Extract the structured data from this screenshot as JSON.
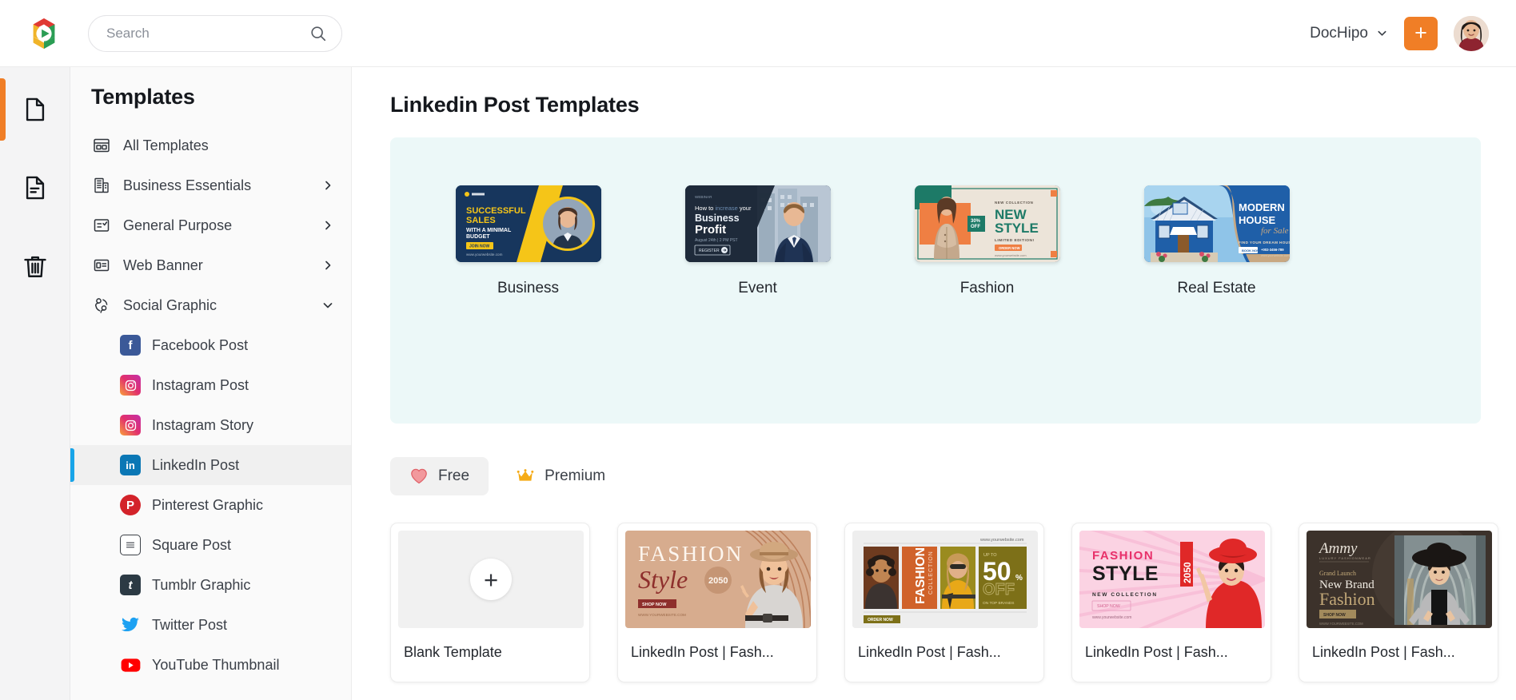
{
  "topbar": {
    "logo_icon": "dochipo-logo-icon",
    "search": {
      "value": "",
      "placeholder": "Search",
      "icon": "search-icon"
    },
    "workspace": {
      "name": "DocHipo",
      "chevron_icon": "chevron-down-icon"
    },
    "add_button": {
      "label": "+",
      "icon": "plus-icon",
      "color": "#f07e26"
    },
    "avatar": {
      "alt": "user-avatar"
    }
  },
  "rail": {
    "items": [
      {
        "icon": "document-blank-icon",
        "active": true
      },
      {
        "icon": "document-lines-icon",
        "active": false
      },
      {
        "icon": "trash-icon",
        "active": false
      }
    ],
    "active_color": "#f07e26"
  },
  "sidebar": {
    "title": "Templates",
    "nav": [
      {
        "label": "All Templates",
        "icon": "grid-layout-icon",
        "arrow": ""
      },
      {
        "label": "Business Essentials",
        "icon": "building-icon",
        "arrow": "chevron-right-icon"
      },
      {
        "label": "General Purpose",
        "icon": "checklist-icon",
        "arrow": "chevron-right-icon"
      },
      {
        "label": "Web Banner",
        "icon": "banner-icon",
        "arrow": "chevron-right-icon"
      },
      {
        "label": "Social Graphic",
        "icon": "people-icon",
        "arrow": "chevron-down-icon",
        "expanded": true
      }
    ],
    "sub_items": [
      {
        "label": "Facebook Post",
        "icon": "facebook-icon",
        "color": "#3b5998",
        "active": false
      },
      {
        "label": "Instagram Post",
        "icon": "instagram-icon",
        "color": "#e1306c",
        "active": false
      },
      {
        "label": "Instagram Story",
        "icon": "instagram-icon",
        "color": "#e1306c",
        "active": false
      },
      {
        "label": "LinkedIn Post",
        "icon": "linkedin-icon",
        "color": "#0a77b5",
        "active": true
      },
      {
        "label": "Pinterest Graphic",
        "icon": "pinterest-icon",
        "color": "#d3232a",
        "active": false
      },
      {
        "label": "Square Post",
        "icon": "square-post-icon",
        "color": "#ffffff",
        "active": false
      },
      {
        "label": "Tumblr Graphic",
        "icon": "tumblr-icon",
        "color": "#2c3a44",
        "active": false
      },
      {
        "label": "Twitter Post",
        "icon": "twitter-icon",
        "color": "#1da1f2",
        "active": false
      },
      {
        "label": "YouTube Thumbnail",
        "icon": "youtube-icon",
        "color": "#ff0000",
        "active": false
      }
    ],
    "active_indicator_color": "#18a4e8"
  },
  "main": {
    "page_title": "Linkedin Post Templates",
    "category_panel_bg": "#ecf8f8",
    "categories": [
      {
        "label": "Business",
        "thumb_headline": "SUCCESSFUL SALES",
        "thumb_sub": "WITH A MINIMAL BUDGET",
        "thumb_cta": "JOIN NOW",
        "thumb_url": "www.yourwebsite.com",
        "bg": "#17365d",
        "accent": "#f5c518"
      },
      {
        "label": "Event",
        "thumb_headline": "Business Profit",
        "thumb_sub": "How to increase your",
        "thumb_cta": "REGISTER",
        "thumb_url": "August 24th | 2 PM PST",
        "bg": "#1e2a3a",
        "accent": "#ffffff"
      },
      {
        "label": "Fashion",
        "thumb_headline": "NEW STYLE",
        "thumb_sub": "LIMITED EDITION!",
        "thumb_cta": "ORDER NOW",
        "thumb_url": "30% OFF",
        "bg": "#ece4d9",
        "accent": "#1d7a67"
      },
      {
        "label": "Real Estate",
        "thumb_headline": "MODERN HOUSE",
        "thumb_sub": "for Sale",
        "thumb_cta": "BOOK NOW",
        "thumb_url": "FIND YOUR DREAM HOUSE",
        "bg": "#1f5fa8",
        "accent": "#c8a882"
      }
    ],
    "filters": [
      {
        "label": "Free",
        "icon": "heart-icon",
        "color": "#ef8186",
        "active": true
      },
      {
        "label": "Premium",
        "icon": "crown-icon",
        "color": "#f5ab16",
        "active": false
      }
    ],
    "templates": [
      {
        "label": "Blank Template",
        "kind": "blank",
        "plus": "+"
      },
      {
        "label": "LinkedIn Post | Fash...",
        "kind": "thumb",
        "thumb_id": "fashion-style-2050-tan",
        "bg": "#d7ac8e",
        "headline": "FASHION",
        "script": "Style",
        "badge": "2050",
        "cta": "SHOP NOW"
      },
      {
        "label": "LinkedIn Post | Fash...",
        "kind": "thumb",
        "thumb_id": "fashion-collection-50off",
        "bg": "#eeeeee",
        "headline": "FASHION",
        "script": "COLLECTION",
        "badge": "50",
        "cta": "ORDER NOW"
      },
      {
        "label": "LinkedIn Post | Fash...",
        "kind": "thumb",
        "thumb_id": "fashion-style-2050-pink",
        "bg": "#fbd3e3",
        "headline": "FASHION STYLE",
        "script": "NEW COLLECTION",
        "badge": "2050",
        "cta": "SHOP NOW"
      },
      {
        "label": "LinkedIn Post | Fash...",
        "kind": "thumb",
        "thumb_id": "ammy-new-brand-fashion",
        "bg": "#3c322b",
        "headline": "Fashion",
        "script": "New Brand",
        "badge": "Ammy",
        "cta": "SHOP NOW"
      }
    ]
  }
}
